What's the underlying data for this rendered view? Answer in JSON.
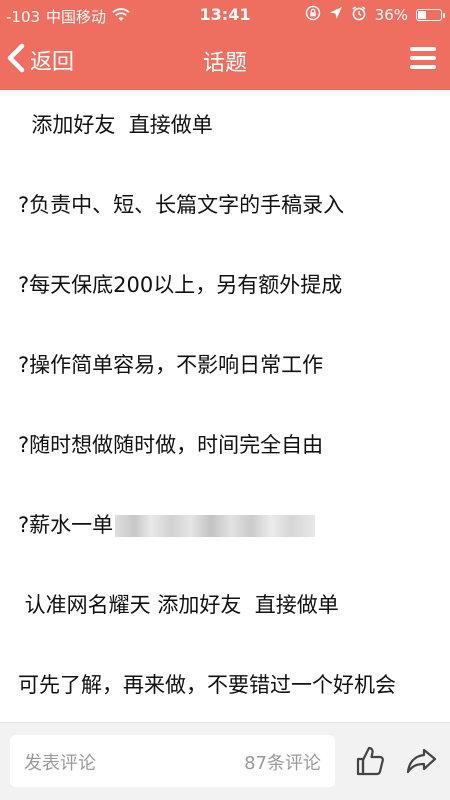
{
  "status_bar": {
    "signal": "-103",
    "carrier": "中国移动",
    "time": "13:41",
    "battery": "36%",
    "battery_level": 0.36
  },
  "nav": {
    "back_label": "返回",
    "title": "话题"
  },
  "content": {
    "lines": [
      "  添加好友  直接做单",
      "?负责中、短、长篇文字的手稿录入",
      "?每天保底200以上，另有额外提成",
      "?操作简单容易，不影响日常工作",
      "?随时想做随时做，时间完全自由",
      "?薪水一单",
      " 认准网名耀天 添加好友  直接做单",
      "可先了解，再来做，不要错过一个好机会"
    ]
  },
  "bottom_bar": {
    "comment_placeholder": "发表评论",
    "comment_count": "87条评论"
  },
  "colors": {
    "header": "#ee6e60",
    "text": "#111111",
    "muted": "#9a9a9a"
  },
  "icons": [
    "wifi-icon",
    "lock-rotation-icon",
    "location-icon",
    "alarm-icon",
    "battery-icon",
    "chevron-left-icon",
    "menu-icon",
    "like-icon",
    "share-icon"
  ]
}
